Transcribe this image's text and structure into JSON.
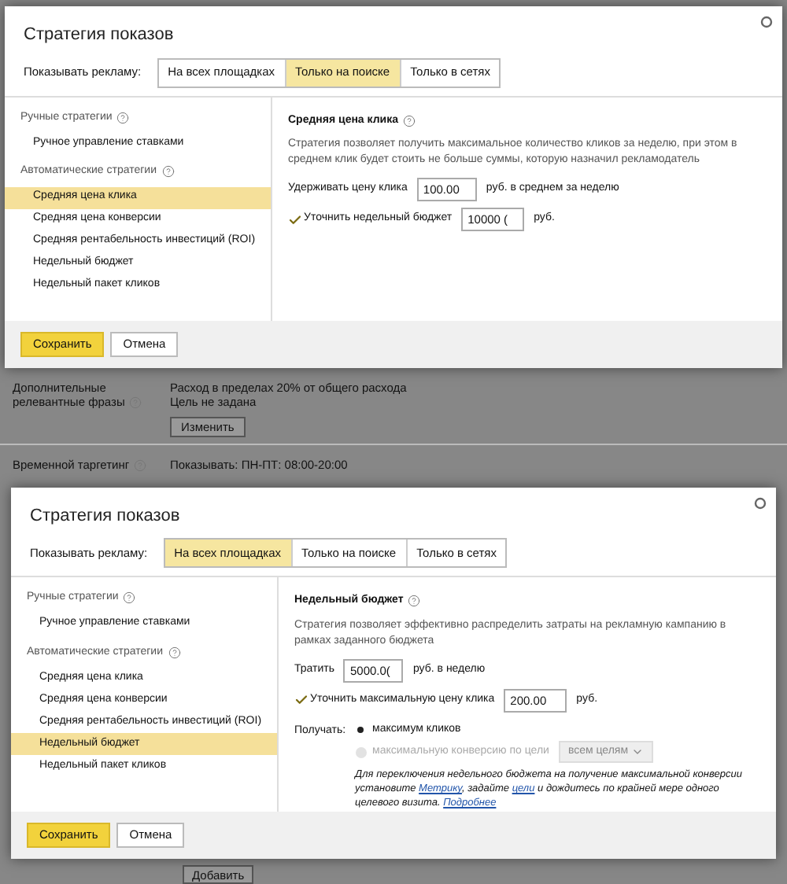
{
  "dialogs": [
    {
      "title": "Стратегия показов",
      "show_label": "Показывать рекламу:",
      "tabs": [
        {
          "label": "На всех площадках",
          "selected": false
        },
        {
          "label": "Только на поиске",
          "selected": true
        },
        {
          "label": "Только в сетях",
          "selected": false
        }
      ],
      "groups": [
        {
          "label": "Ручные стратегии",
          "items": [
            {
              "label": "Ручное управление ставками",
              "selected": false
            }
          ]
        },
        {
          "label": "Автоматические стратегии",
          "items": [
            {
              "label": "Средняя цена клика",
              "selected": true
            },
            {
              "label": "Средняя цена конверсии",
              "selected": false
            },
            {
              "label": "Средняя рентабельность инвестиций (ROI)",
              "selected": false
            },
            {
              "label": "Недельный бюджет",
              "selected": false
            },
            {
              "label": "Недельный пакет кликов",
              "selected": false
            }
          ]
        }
      ],
      "panel": {
        "heading": "Средняя цена клика",
        "description": "Стратегия позволяет получить максимальное количество кликов за неделю, при этом в среднем клик будет стоить не больше суммы, которую назначил рекламодатель",
        "rows": [
          {
            "kind": "field",
            "label": "Удерживать цену клика",
            "value": "100.00",
            "suffix": "руб. в среднем за неделю"
          },
          {
            "kind": "check_field",
            "label": "Уточнить недельный бюджет",
            "checked": true,
            "value": "10000 (",
            "suffix": "руб."
          }
        ]
      },
      "buttons": [
        {
          "label": "Сохранить",
          "primary": true
        },
        {
          "label": "Отмена",
          "primary": false
        }
      ]
    },
    {
      "title": "Стратегия показов",
      "show_label": "Показывать рекламу:",
      "tabs": [
        {
          "label": "На всех площадках",
          "selected": true
        },
        {
          "label": "Только на поиске",
          "selected": false
        },
        {
          "label": "Только в сетях",
          "selected": false
        }
      ],
      "groups": [
        {
          "label": "Ручные стратегии",
          "items": [
            {
              "label": "Ручное управление ставками",
              "selected": false
            }
          ]
        },
        {
          "label": "Автоматические стратегии",
          "items": [
            {
              "label": "Средняя цена клика",
              "selected": false
            },
            {
              "label": "Средняя цена конверсии",
              "selected": false
            },
            {
              "label": "Средняя рентабельность инвестиций (ROI)",
              "selected": false
            },
            {
              "label": "Недельный бюджет",
              "selected": true
            },
            {
              "label": "Недельный пакет кликов",
              "selected": false
            }
          ]
        }
      ],
      "panel": {
        "heading": "Недельный бюджет",
        "description": "Стратегия позволяет эффективно распределить затраты на рекламную кампанию в рамках заданного бюджета",
        "rows": [
          {
            "kind": "field",
            "label": "Тратить",
            "value": "5000.0(",
            "suffix": "руб. в неделю"
          },
          {
            "kind": "check_field",
            "label": "Уточнить максимальную цену клика",
            "checked": true,
            "value": "200.00",
            "suffix": "руб."
          },
          {
            "kind": "radio_group",
            "label": "Получать:",
            "options": [
              {
                "label": "максимум кликов",
                "selected": true,
                "disabled": false
              },
              {
                "label": "максимальную конверсию по цели",
                "selected": false,
                "disabled": true,
                "dropdown": "всем целям"
              }
            ],
            "note": [
              {
                "text": "Для переключения недельного бюджета на получение максимальной конверсии установите ",
                "link": false
              },
              {
                "text": "Метрику",
                "link": true
              },
              {
                "text": ", задайте ",
                "link": false
              },
              {
                "text": "цели",
                "link": true
              },
              {
                "text": " и дождитесь по крайней мере одного целевого визита. ",
                "link": false
              },
              {
                "text": "Подробнее",
                "link": true
              }
            ]
          }
        ]
      },
      "buttons": [
        {
          "label": "Сохранить",
          "primary": true
        },
        {
          "label": "Отмена",
          "primary": false
        }
      ]
    }
  ],
  "background": {
    "rows": [
      {
        "label": "Дополнительные релевантные фразы",
        "lines": [
          "Расход в пределах 20% от общего расхода",
          "Цель не задана"
        ],
        "button": "Изменить"
      },
      {
        "label": "Временной таргетинг",
        "lines": [
          "Показывать: ПН-ПТ: 08:00-20:00"
        ]
      }
    ],
    "bottom_button": "Добавить"
  }
}
